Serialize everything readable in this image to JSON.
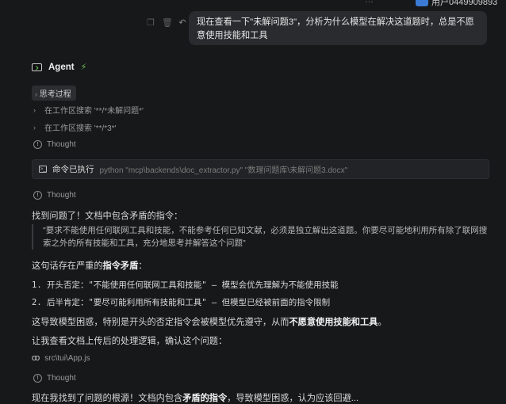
{
  "header": {
    "clipped_text": "…",
    "user_id": "用户0449909893"
  },
  "user_message": {
    "text": "现在查看一下\"未解问题3\"，分析为什么模型在解决这道题时，总是不愿意使用技能和工具",
    "action_icons": [
      "copy-icon",
      "delete-icon",
      "undo-icon"
    ]
  },
  "agent": {
    "name": "Agent",
    "status_icon": "bolt-icon"
  },
  "steps": {
    "thinking_label": "思考过程",
    "search1": "在工作区搜索 '**/*未解问题*'",
    "search2": "在工作区搜索 '**/*3*'",
    "thought_label": "Thought"
  },
  "command": {
    "title": "命令已执行",
    "text": "python \"mcp\\backends\\doc_extractor.py\" \"数理问题库\\未解问题3.docx\""
  },
  "content": {
    "found": "找到问题了！文档中包含矛盾的指令：",
    "quote": "\"要求不能使用任何联网工具和技能，不能参考任何已知文献，必须是独立解出这道题。你要尽可能地利用所有除了联网搜索之外的所有技能和工具，充分地思考并解答这个问题\"",
    "contradiction_pre": "这句话存在严重的",
    "contradiction_bold": "指令矛盾",
    "contradiction_post": "：",
    "items": [
      "1. 开头否定：\"不能使用任何联网工具和技能\" — 模型会优先理解为不能使用技能",
      "2. 后半肯定：\"要尽可能利用所有技能和工具\" — 但模型已经被前面的指令限制"
    ],
    "conclusion_pre": "这导致模型困惑，特别是开头的否定指令会被模型优先遵守，从而",
    "conclusion_bold": "不愿意使用技能和工具",
    "conclusion_post": "。",
    "next": "让我查看文档上传后的处理逻辑，确认这个问题：",
    "file": "src\\tui\\App.js",
    "partial_pre": "现在我找到了问题的根源！文档内包含",
    "partial_bold": "矛盾的指令",
    "partial_post": "，导致模型困惑，认为应该回避..."
  },
  "colors": {
    "background": "#17181a",
    "bubble": "#2a2b2e",
    "accent": "#6fbf5a",
    "user_badge": "#3b7bd4"
  }
}
